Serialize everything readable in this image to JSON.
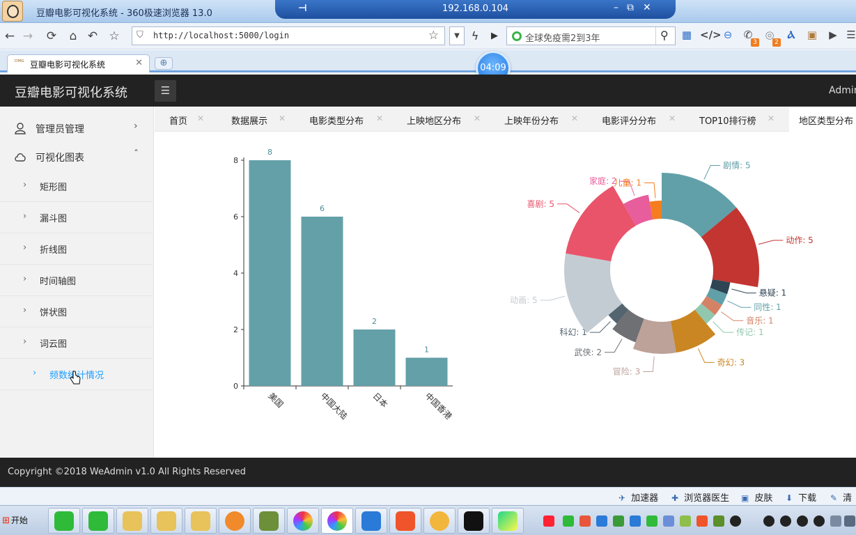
{
  "window": {
    "title": "豆瓣电影可视化系统 - 360极速浏览器 13.0",
    "remote_ip": "192.168.0.104",
    "remote_pin": "⊣",
    "remote_controls": [
      "–",
      "⧉",
      "✕"
    ]
  },
  "browser": {
    "url": "http://localhost:5000/login",
    "search_placeholder": "全球免疫需2到3年",
    "tab_label": "豆瓣电影可视化系统",
    "tab_icon_text": "ᴰᴹᴳ",
    "timer": "04:09",
    "ext_badges": [
      "3",
      "2"
    ]
  },
  "app": {
    "brand": "豆瓣电影可视化系统",
    "user": "Admin",
    "footer": "Copyright ©2018 WeAdmin v1.0 All Rights Reserved"
  },
  "sidebar": {
    "groups": [
      {
        "label": "管理员管理",
        "icon": "user-icon",
        "arrow": "›"
      },
      {
        "label": "可视化图表",
        "icon": "cloud-icon",
        "arrow": "ˆ"
      }
    ],
    "items": [
      {
        "label": "矩形图"
      },
      {
        "label": "漏斗图"
      },
      {
        "label": "折线图"
      },
      {
        "label": "时间轴图"
      },
      {
        "label": "饼状图"
      },
      {
        "label": "词云图"
      },
      {
        "label": "频数统计情况"
      }
    ]
  },
  "content_tabs": [
    "首页",
    "数据展示",
    "电影类型分布",
    "上映地区分布",
    "上映年份分布",
    "电影评分分布",
    "TOP10排行榜",
    "地区类型分布"
  ],
  "statusbar": [
    {
      "label": "加速器",
      "icon": "accelerator-icon"
    },
    {
      "label": "浏览器医生",
      "icon": "doctor-icon"
    },
    {
      "label": "皮肤",
      "icon": "skin-icon"
    },
    {
      "label": "下载",
      "icon": "download-icon"
    },
    {
      "label": "清",
      "icon": "clean-icon"
    }
  ],
  "taskbar": {
    "start_label": "开始"
  },
  "colors": {
    "bar": "#64a0a8",
    "header": "#222222",
    "active_link": "#1e9fff"
  },
  "chart_data": [
    {
      "type": "bar",
      "categories": [
        "美国",
        "中国大陆",
        "日本",
        "中国香港"
      ],
      "values": [
        8,
        6,
        2,
        1
      ],
      "data_labels": [
        "8",
        "6",
        "2",
        "1"
      ],
      "ylim": [
        0,
        8
      ],
      "yticks": [
        "0",
        "2",
        "4",
        "6",
        "8"
      ],
      "title": "",
      "xlabel": "",
      "ylabel": ""
    },
    {
      "type": "pie",
      "variant": "rose-donut",
      "slices": [
        {
          "name": "剧情",
          "value": 5,
          "label": "剧情: 5",
          "color": "#61a0a8"
        },
        {
          "name": "动作",
          "value": 5,
          "label": "动作: 5",
          "color": "#c23531"
        },
        {
          "name": "悬疑",
          "value": 1,
          "label": "悬疑: 1",
          "color": "#2f4554"
        },
        {
          "name": "同性",
          "value": 1,
          "label": "同性: 1",
          "color": "#61a0a8"
        },
        {
          "name": "音乐",
          "value": 1,
          "label": "音乐: 1",
          "color": "#d48265"
        },
        {
          "name": "传记",
          "value": 1,
          "label": "传记: 1",
          "color": "#91c7ae"
        },
        {
          "name": "奇幻",
          "value": 3,
          "label": "奇幻: 3",
          "color": "#ca8622"
        },
        {
          "name": "冒险",
          "value": 3,
          "label": "冒险: 3",
          "color": "#bda29a"
        },
        {
          "name": "武侠",
          "value": 2,
          "label": "武侠: 2",
          "color": "#6e7074"
        },
        {
          "name": "科幻",
          "value": 1,
          "label": "科幻: 1",
          "color": "#546570"
        },
        {
          "name": "动画",
          "value": 5,
          "label": "动画: 5",
          "color": "#c4ccd3"
        },
        {
          "name": "喜剧",
          "value": 5,
          "label": "喜剧: 5",
          "color": "#e9546b"
        },
        {
          "name": "家庭",
          "value": 2,
          "label": "家庭: 2",
          "color": "#e85d9b"
        },
        {
          "name": "儿童",
          "value": 1,
          "label": "儿童: 1",
          "color": "#f57c1f"
        }
      ]
    }
  ]
}
